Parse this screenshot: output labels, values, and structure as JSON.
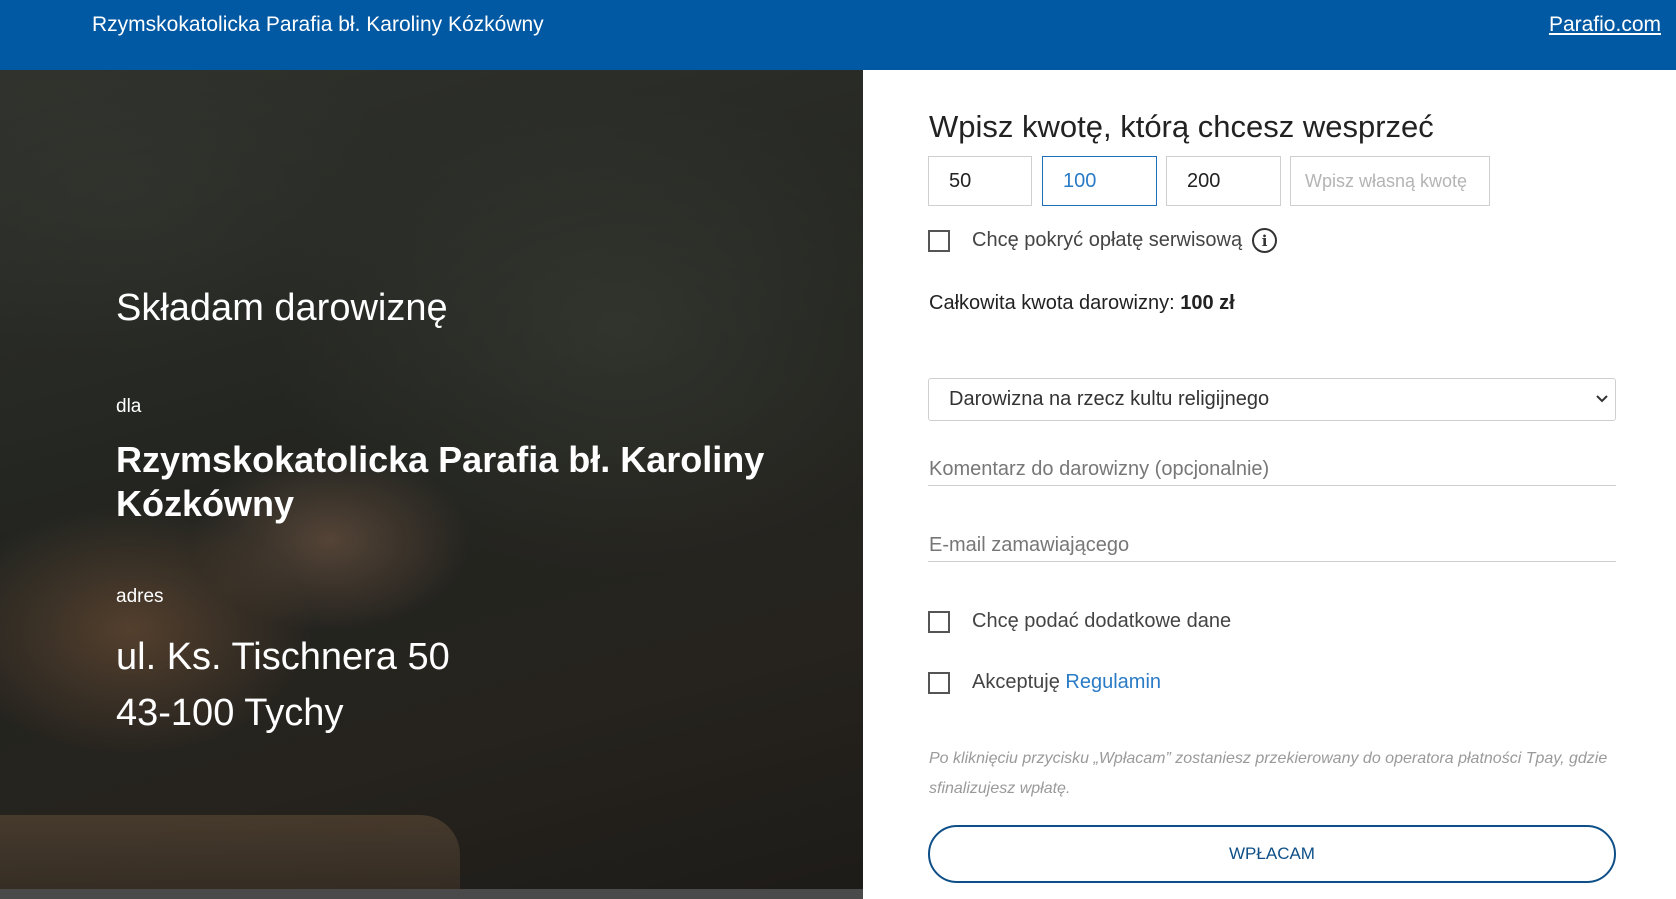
{
  "header": {
    "brand": "Rzymskokatolicka Parafia bł. Karoliny Kózkówny",
    "link": "Parafio.com",
    "color": "#0158a3"
  },
  "hero": {
    "intro": "Składam darowiznę",
    "for_label": "dla",
    "org_name": "Rzymskokatolicka Parafia bł. Karoliny Kózkówny",
    "address_label": "adres",
    "address_line1": "ul. Ks. Tischnera 50",
    "address_line2": "43-100 Tychy"
  },
  "form": {
    "title": "Wpisz kwotę, którą chcesz wesprzeć",
    "amounts": [
      "50",
      "100",
      "200"
    ],
    "selected_amount": "100",
    "custom_amount_placeholder": "Wpisz własną kwotę",
    "service_fee_label": "Chcę pokryć opłatę serwisową",
    "service_fee_checked": false,
    "total_label": "Całkowita kwota darowizny:",
    "total_value": "100 zł",
    "purpose_selected": "Darowizna na rzecz kultu religijnego",
    "comment_placeholder": "Komentarz do darowizny (opcjonalnie)",
    "email_placeholder": "E-mail zamawiającego",
    "extra_data_label": "Chcę podać dodatkowe dane",
    "extra_data_checked": false,
    "accept_label": "Akceptuję",
    "accept_link": "Regulamin",
    "accept_checked": false,
    "note": "Po kliknięciu przycisku „Wpłacam” zostaniesz przekierowany do operatora płatności Tpay, gdzie sfinalizujesz wpłatę.",
    "submit_label": "WPŁACAM",
    "accent_color": "#2a7bc6"
  }
}
